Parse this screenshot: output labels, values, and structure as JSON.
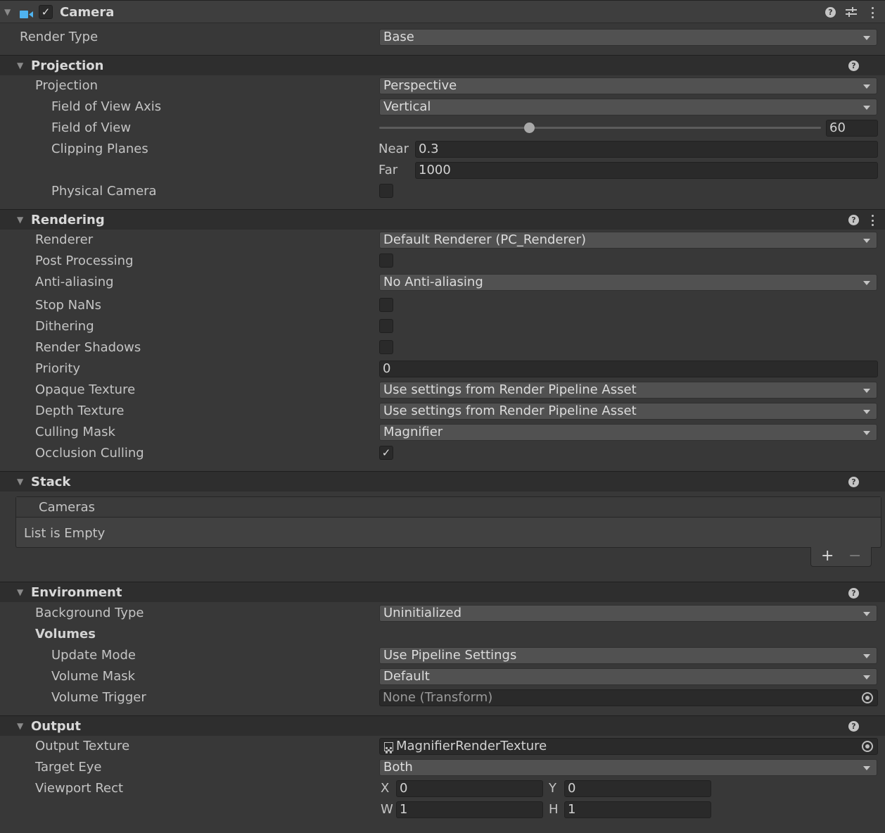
{
  "component": {
    "title": "Camera",
    "enabled": true,
    "icons": [
      "camera-icon",
      "help-icon",
      "preset-icon",
      "kebab-icon"
    ]
  },
  "render_type": {
    "label": "Render Type",
    "value": "Base"
  },
  "projection": {
    "title": "Projection",
    "projection": {
      "label": "Projection",
      "value": "Perspective"
    },
    "fov_axis": {
      "label": "Field of View Axis",
      "value": "Vertical"
    },
    "fov": {
      "label": "Field of View",
      "value": "60",
      "slider_fraction": 0.34
    },
    "clipping": {
      "label": "Clipping Planes",
      "near_label": "Near",
      "near": "0.3",
      "far_label": "Far",
      "far": "1000"
    },
    "physical_camera": {
      "label": "Physical Camera",
      "checked": false
    }
  },
  "rendering": {
    "title": "Rendering",
    "renderer": {
      "label": "Renderer",
      "value": "Default Renderer (PC_Renderer)"
    },
    "post_processing": {
      "label": "Post Processing"
    },
    "anti_aliasing": {
      "label": "Anti-aliasing",
      "value": "No Anti-aliasing"
    },
    "stop_nans": {
      "label": "Stop NaNs"
    },
    "dithering": {
      "label": "Dithering"
    },
    "render_shadows": {
      "label": "Render Shadows"
    },
    "priority": {
      "label": "Priority",
      "value": "0"
    },
    "opaque_texture": {
      "label": "Opaque Texture",
      "value": "Use settings from Render Pipeline Asset"
    },
    "depth_texture": {
      "label": "Depth Texture",
      "value": "Use settings from Render Pipeline Asset"
    },
    "culling_mask": {
      "label": "Culling Mask",
      "value": "Magnifier"
    },
    "occlusion_culling": {
      "label": "Occlusion Culling",
      "checked": true
    }
  },
  "stack": {
    "title": "Stack",
    "list_header": "Cameras",
    "empty_text": "List is Empty",
    "add_glyph": "+",
    "remove_glyph": "−"
  },
  "environment": {
    "title": "Environment",
    "background_type": {
      "label": "Background Type",
      "value": "Uninitialized"
    },
    "volumes_label": "Volumes",
    "update_mode": {
      "label": "Update Mode",
      "value": "Use Pipeline Settings"
    },
    "volume_mask": {
      "label": "Volume Mask",
      "value": "Default"
    },
    "volume_trigger": {
      "label": "Volume Trigger",
      "value": "None (Transform)"
    }
  },
  "output": {
    "title": "Output",
    "output_texture": {
      "label": "Output Texture",
      "value": "MagnifierRenderTexture"
    },
    "target_eye": {
      "label": "Target Eye",
      "value": "Both"
    },
    "viewport": {
      "label": "Viewport Rect",
      "x_label": "X",
      "x": "0",
      "y_label": "Y",
      "y": "0",
      "w_label": "W",
      "w": "1",
      "h_label": "H",
      "h": "1"
    }
  },
  "colors": {
    "accent_icon": "#4fb3f0",
    "background": "#383838",
    "section_header": "#2e2e2e",
    "dropdown": "#515151",
    "field": "#2a2a2a"
  }
}
